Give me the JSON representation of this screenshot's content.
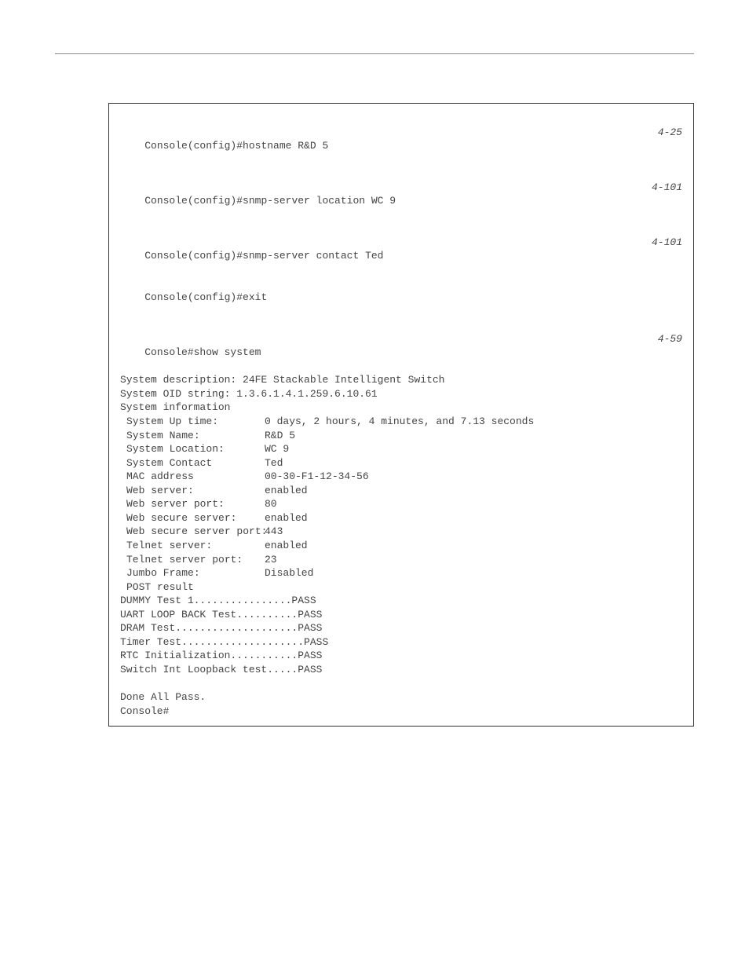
{
  "refs": {
    "r1": "4-25",
    "r2": "4-101",
    "r3": "4-101",
    "r4": "4-59"
  },
  "commands": {
    "c1": "Console(config)#hostname R&D 5",
    "c2": "Console(config)#snmp-server location WC 9",
    "c3": "Console(config)#snmp-server contact Ted",
    "c4": "Console(config)#exit",
    "c5": "Console#show system"
  },
  "output": {
    "desc": "System description: 24FE Stackable Intelligent Switch",
    "oid": "System OID string: 1.3.6.1.4.1.259.6.10.61",
    "sysinfo_header": "System information",
    "kv": [
      {
        "k": "System Up time:",
        "v": "0 days, 2 hours, 4 minutes, and 7.13 seconds"
      },
      {
        "k": "System Name:",
        "v": "R&D 5"
      },
      {
        "k": "System Location:",
        "v": "WC 9"
      },
      {
        "k": "System Contact",
        "v": "Ted"
      },
      {
        "k": "MAC address",
        "v": "00-30-F1-12-34-56"
      },
      {
        "k": "Web server:",
        "v": "enabled"
      },
      {
        "k": "Web server port:",
        "v": "80"
      },
      {
        "k": "Web secure server:",
        "v": "enabled"
      },
      {
        "k": "Web secure server port:",
        "v": "443"
      },
      {
        "k": "Telnet server:",
        "v": "enabled"
      },
      {
        "k": "Telnet server port:",
        "v": "23"
      },
      {
        "k": "Jumbo Frame:",
        "v": "Disabled"
      }
    ],
    "post_header": "POST result",
    "post": [
      "DUMMY Test 1................PASS",
      "UART LOOP BACK Test..........PASS",
      "DRAM Test....................PASS",
      "Timer Test....................PASS",
      "RTC Initialization...........PASS",
      "Switch Int Loopback test.....PASS"
    ],
    "blank": " ",
    "done": "Done All Pass.",
    "prompt": "Console#"
  }
}
